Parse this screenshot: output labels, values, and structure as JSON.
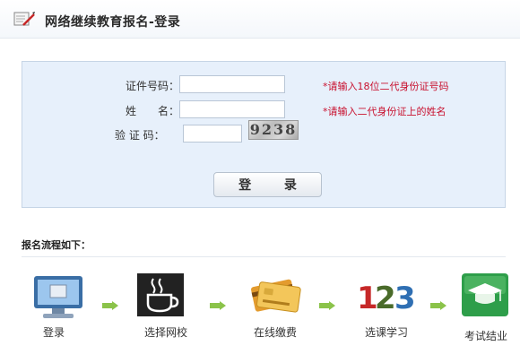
{
  "header": {
    "title": "网络继续教育报名-登录",
    "logo_icon": "notepad-pen-icon"
  },
  "form": {
    "id_label": "证件号码：",
    "id_value": "",
    "id_hint": "*请输入18位二代身份证号码",
    "name_label": "姓　　名：",
    "name_value": "",
    "name_hint": "*请输入二代身份证上的姓名",
    "captcha_label": "验 证 码：",
    "captcha_value": "",
    "captcha_text": "9238",
    "login_label": "登 录"
  },
  "flow": {
    "title": "报名流程如下：",
    "steps": [
      {
        "label": "登录",
        "icon": "computer-monitor-icon"
      },
      {
        "label": "选择网校",
        "icon": "coffee-cup-icon"
      },
      {
        "label": "在线缴费",
        "icon": "credit-cards-icon"
      },
      {
        "label": "选课学习",
        "icon": "numbers-123-icon"
      },
      {
        "label": "考试结业",
        "icon": "graduation-cap-icon"
      }
    ]
  },
  "colors": {
    "hint": "#c8102e",
    "panel_bg": "#e7f0fb",
    "arrow": "#8bc34a"
  }
}
